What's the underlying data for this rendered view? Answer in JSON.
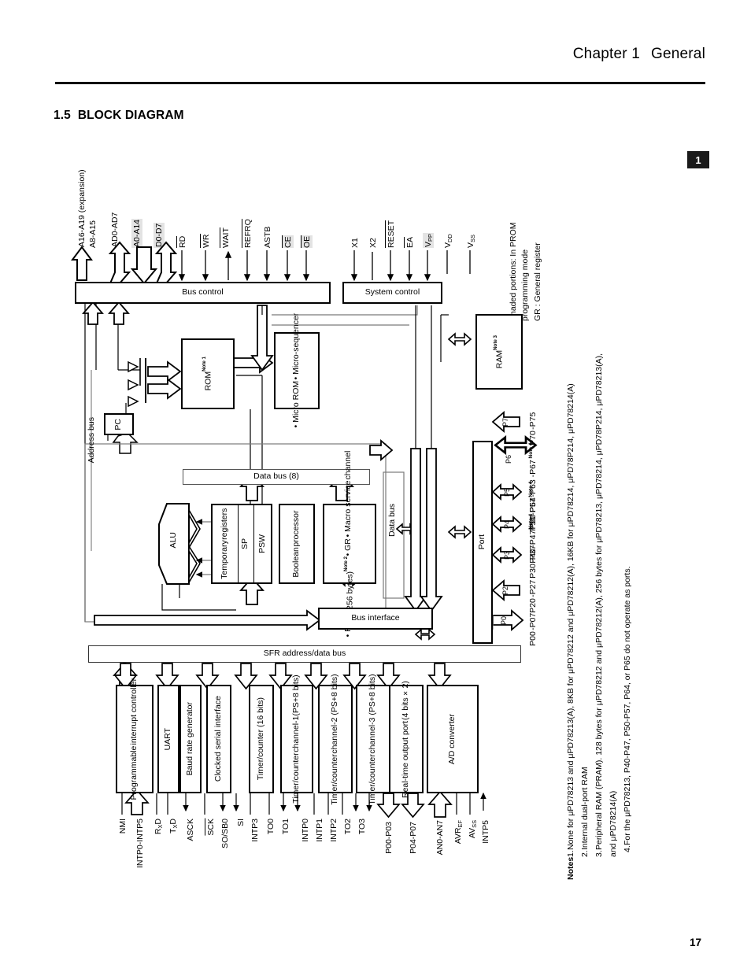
{
  "header": {
    "chapter": "Chapter 1",
    "chapter_title": "General",
    "tab_number": "1"
  },
  "section": {
    "number": "1.5",
    "title": "BLOCK DIAGRAM"
  },
  "page_number": "17",
  "blocks": {
    "bus_control": "Bus control",
    "system_control": "System control",
    "rom": "ROM",
    "rom_note": "Note 1",
    "pc": "PC",
    "micro_rom_line1": "Micro ROM",
    "micro_rom_line2": "Micro-",
    "micro_rom_line3": "sequencer",
    "ram_right": "RAM",
    "ram_right_note": "Note 3",
    "address_bus": "Address bus",
    "data_bus_8": "Data bus (8)",
    "data_bus": "Data bus",
    "alu": "ALU",
    "temporary_registers_l1": "Temporary",
    "temporary_registers_l2": "registers",
    "sp": "SP",
    "psw": "PSW",
    "boolean_l1": "Boolean",
    "boolean_l2": "processor",
    "ram_core_l1": "RAM",
    "ram_core_l2": "(256 bytes)",
    "ram_core_note": "Note 2",
    "ram_core_l3": "GR",
    "ram_core_l4": "Macro service",
    "ram_core_l5": "channel",
    "bus_interface": "Bus interface",
    "sfr_bus": "SFR address/data bus",
    "port": "Port"
  },
  "peripherals": [
    {
      "name": "interrupt-controller",
      "lines": [
        "Programmable",
        "interrupt controller"
      ]
    },
    {
      "name": "uart",
      "lines": [
        "UART"
      ]
    },
    {
      "name": "baud-rate-generator",
      "lines": [
        "Baud rate generator"
      ]
    },
    {
      "name": "clocked-serial-interface",
      "lines": [
        "Clocked serial interface"
      ]
    },
    {
      "name": "timer-counter-16bit",
      "lines": [
        "Timer/counter (16 bits)"
      ]
    },
    {
      "name": "timer-counter-ch1",
      "lines": [
        "Timer/counter",
        "channel-1(PS+8 bits)"
      ]
    },
    {
      "name": "timer-counter-ch2",
      "lines": [
        "Timer/counter",
        "channel-2 (PS+8 bits)"
      ]
    },
    {
      "name": "timer-counter-ch3",
      "lines": [
        "Timer/counter",
        "channel-3 (PS+8 bits)"
      ]
    },
    {
      "name": "realtime-output-port",
      "lines": [
        "Real-time output port",
        "(4 bits×2)"
      ]
    },
    {
      "name": "ad-converter",
      "lines": [
        "A/D converter"
      ]
    }
  ],
  "top_pins": [
    {
      "label": "A16-A19 (expansion)",
      "shaded": false,
      "overline": false
    },
    {
      "label": "A8-A15",
      "shaded": false,
      "overline": false
    },
    {
      "label": "AD0-AD7",
      "shaded": false,
      "overline": false
    },
    {
      "label": "A0-A14",
      "shaded": true,
      "overline": false
    },
    {
      "label": "D0-D7",
      "shaded": true,
      "overline": false
    },
    {
      "label": "RD",
      "shaded": false,
      "overline": true
    },
    {
      "label": "WR",
      "shaded": false,
      "overline": true
    },
    {
      "label": "WAIT",
      "shaded": false,
      "overline": true
    },
    {
      "label": "REFRQ",
      "shaded": false,
      "overline": true
    },
    {
      "label": "ASTB",
      "shaded": false,
      "overline": false
    },
    {
      "label": "CE",
      "shaded": true,
      "overline": true
    },
    {
      "label": "OE",
      "shaded": true,
      "overline": true
    }
  ],
  "system_pins": [
    {
      "label": "X1",
      "shaded": false,
      "overline": false
    },
    {
      "label": "X2",
      "shaded": false,
      "overline": false
    },
    {
      "label": "RESET",
      "shaded": false,
      "overline": true
    },
    {
      "label": "EA",
      "shaded": false,
      "overline": true
    },
    {
      "label": "VPP",
      "shaded": true,
      "overline": false
    },
    {
      "label": "VDD",
      "shaded": false,
      "overline": false
    },
    {
      "label": "VSS",
      "shaded": false,
      "overline": false
    }
  ],
  "legend": {
    "shaded_line1": "Shaded portions:  In PROM",
    "shaded_line2": "programming mode",
    "gr_line": "GR :  General register"
  },
  "ports": [
    {
      "tag": "P0",
      "line1": "P00",
      "line2": "-P07",
      "note": ""
    },
    {
      "tag": "P2",
      "line1": "P20",
      "line2": "-P27",
      "note": ""
    },
    {
      "tag": "P3",
      "line1": "P30",
      "line2": "-P37",
      "note": ""
    },
    {
      "tag": "P4",
      "line1": "P40",
      "line2": "-P47",
      "note": "Note 4"
    },
    {
      "tag": "P5",
      "line1": "P50",
      "line2": "-P57",
      "note": "Note 4"
    },
    {
      "tag": "P6",
      "line1": "P60  P64",
      "line2": "-P63 -P67",
      "note": "Note 4"
    },
    {
      "tag": "P7",
      "line1": "P70",
      "line2": "-P75",
      "note": ""
    }
  ],
  "bottom_pins": [
    {
      "label": "NMI"
    },
    {
      "label": "INTP0-INTP5"
    },
    {
      "label": "RxD"
    },
    {
      "label": "TxD"
    },
    {
      "label": "ASCK"
    },
    {
      "label": "SCK",
      "overline": true
    },
    {
      "label": "SO/SB0"
    },
    {
      "label": "SI"
    },
    {
      "label": "INTP3"
    },
    {
      "label": "TO0"
    },
    {
      "label": "TO1"
    },
    {
      "label": "INTP0"
    },
    {
      "label": "INTP1"
    },
    {
      "label": "INTP2"
    },
    {
      "label": "TO2"
    },
    {
      "label": "TO3"
    },
    {
      "label": "P00-P03"
    },
    {
      "label": "P04-P07"
    },
    {
      "label": "AN0-AN7"
    },
    {
      "label": "AVREF"
    },
    {
      "label": "AVSS"
    },
    {
      "label": "INTP5"
    }
  ],
  "notes": {
    "heading": "Notes",
    "items": [
      {
        "num": "1.",
        "text": "None for μPD78213 and μPD78213(A), 8KB for μPD78212 and μPD78212(A), 16KB for μPD78214, μPD78P214, μPD78214(A)"
      },
      {
        "num": "2.",
        "text": "Internal dual-port RAM"
      },
      {
        "num": "3.",
        "text": "Peripheral RAM (PRAM).  128 bytes for μPD78212 and μPD78212(A), 256 bytes for μPD78213, μPD78214, μPD78P214, μPD78213(A),"
      },
      {
        "num": "",
        "text": "and μPD78214(A)"
      },
      {
        "num": "4.",
        "text": "For the μPD78213, P40-P47, P50-P57, P64, or P65 do not operate as ports."
      }
    ]
  }
}
